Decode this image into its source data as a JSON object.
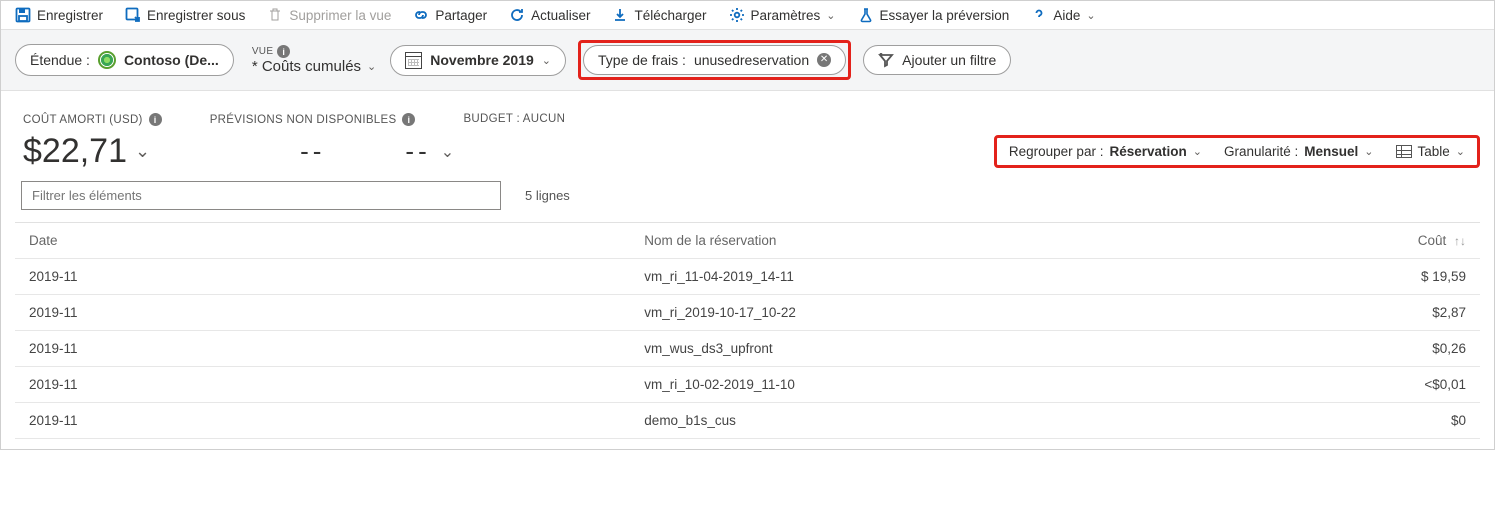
{
  "toolbar": {
    "save": "Enregistrer",
    "save_as": "Enregistrer sous",
    "delete_view": "Supprimer la vue",
    "share": "Partager",
    "refresh": "Actualiser",
    "download": "Télécharger",
    "settings": "Paramètres",
    "try_preview": "Essayer la préversion",
    "help": "Aide"
  },
  "filter_bar": {
    "scope_label": "Étendue :",
    "scope_value": "Contoso (De...",
    "view_caption": "VUE",
    "view_value": "* Coûts cumulés",
    "date_value": "Novembre 2019",
    "charge_type_label": "Type de frais :",
    "charge_type_value": "unusedreservation",
    "add_filter": "Ajouter un filtre"
  },
  "metrics": {
    "amortized_label": "COÛT AMORTI (USD)",
    "amortized_value": "$22,71",
    "forecast_label": "PRÉVISIONS NON DISPONIBLES",
    "forecast_value": "--",
    "budget_label": "BUDGET : AUCUN",
    "budget_value": "--"
  },
  "right_controls": {
    "group_by_label": "Regrouper par :",
    "group_by_value": "Réservation",
    "granularity_label": "Granularité :",
    "granularity_value": "Mensuel",
    "view_mode": "Table"
  },
  "filter_input": {
    "placeholder": "Filtrer les éléments",
    "lines": "5 lignes"
  },
  "table": {
    "columns": {
      "date": "Date",
      "name": "Nom de la réservation",
      "cost": "Coût"
    },
    "rows": [
      {
        "date": "2019-11",
        "name": "vm_ri_11-04-2019_14-11",
        "cost": "$ 19,59"
      },
      {
        "date": "2019-11",
        "name": "vm_ri_2019-10-17_10-22",
        "cost": "$2,87"
      },
      {
        "date": "2019-11",
        "name": "vm_wus_ds3_upfront",
        "cost": "$0,26"
      },
      {
        "date": "2019-11",
        "name": "vm_ri_10-02-2019_11-10",
        "cost": "<$0,01"
      },
      {
        "date": "2019-11",
        "name": "demo_b1s_cus",
        "cost": "$0"
      }
    ]
  }
}
